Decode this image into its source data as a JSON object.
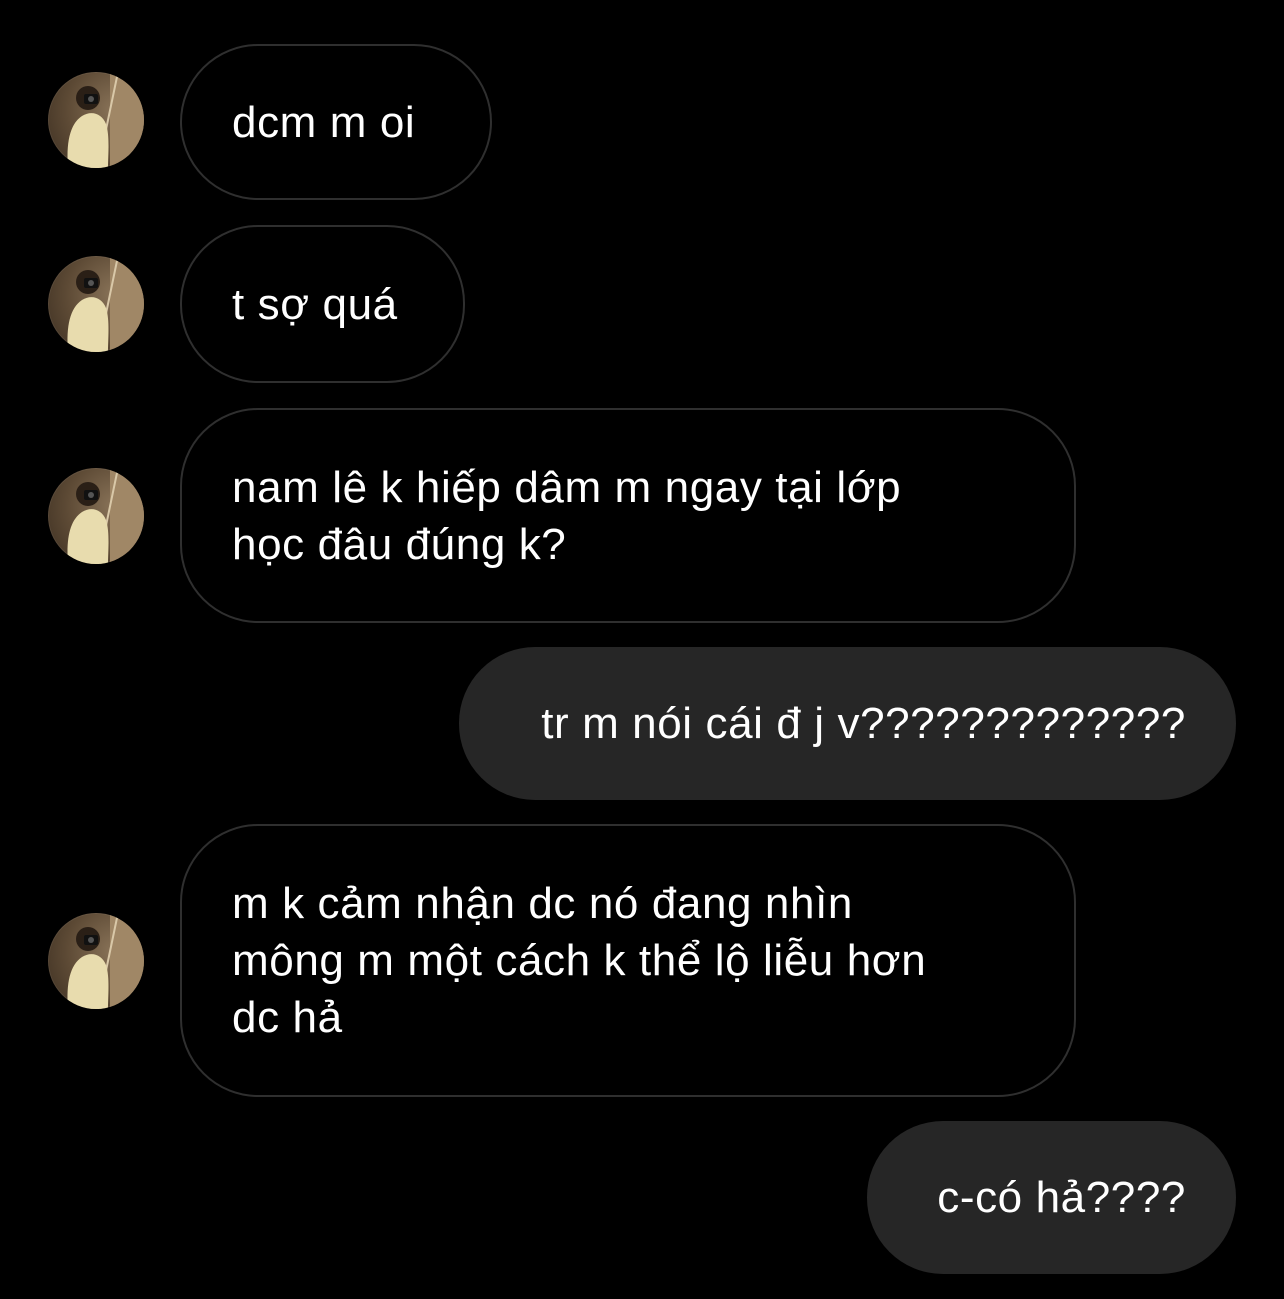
{
  "conversation": {
    "messages": [
      {
        "direction": "incoming",
        "text": "dcm m oi"
      },
      {
        "direction": "incoming",
        "text": "t sợ quá"
      },
      {
        "direction": "incoming",
        "text": "nam lê k hiếp dâm m ngay tại lớp\nhọc đâu đúng k?"
      },
      {
        "direction": "outgoing",
        "text": "tr m nói cái đ j v?????????????"
      },
      {
        "direction": "incoming",
        "text": "m k cảm nhận dc nó đang nhìn\nmông m một cách k thể lộ liễu hơn\ndc hả"
      },
      {
        "direction": "outgoing",
        "text": "c-có hả????"
      }
    ]
  },
  "contact": {
    "avatar_icon": "profile-photo-avatar"
  },
  "colors": {
    "background": "#000000",
    "incoming_border": "#2f2f2f",
    "outgoing_bubble": "#262626",
    "text": "#ffffff"
  }
}
